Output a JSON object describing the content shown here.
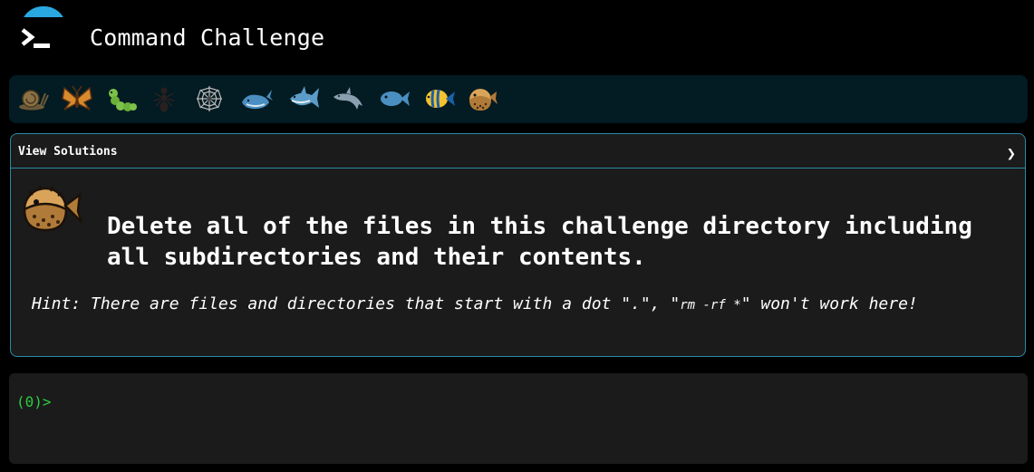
{
  "app": {
    "title": "Command Challenge"
  },
  "levels": [
    {
      "icon": "snail-icon"
    },
    {
      "icon": "butterfly-icon"
    },
    {
      "icon": "caterpillar-icon"
    },
    {
      "icon": "ant-icon"
    },
    {
      "icon": "spider-web-icon"
    },
    {
      "icon": "whale-icon"
    },
    {
      "icon": "shark-icon"
    },
    {
      "icon": "dolphin-icon"
    },
    {
      "icon": "fish-icon"
    },
    {
      "icon": "tropical-fish-icon"
    },
    {
      "icon": "blowfish-icon"
    }
  ],
  "panel": {
    "solutions_label": "View Solutions",
    "chevron": "❯",
    "challenge_text": "Delete all of the files in this challenge directory including all subdirectories and their contents.",
    "hint_before": "Hint: There are files and directories that start with a dot \".\", \"",
    "hint_code": "rm -rf *",
    "hint_after": "\" won't work here!"
  },
  "terminal": {
    "prompt": "(0)>"
  },
  "colors": {
    "accent": "#29a9e0",
    "panel_border": "#2a8aa6",
    "prompt": "#2ecc40"
  }
}
